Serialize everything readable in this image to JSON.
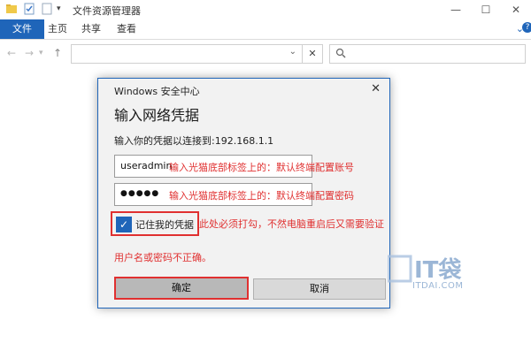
{
  "window": {
    "title": "文件资源管理器",
    "controls": [
      "minimize-icon",
      "maximize-icon",
      "close-icon"
    ]
  },
  "ribbon": {
    "tabs": [
      "文件",
      "主页",
      "共享",
      "查看"
    ],
    "help_glyph": "?"
  },
  "address_bar": {
    "value": "",
    "search_placeholder": ""
  },
  "dialog": {
    "title": "Windows 安全中心",
    "heading": "输入网络凭据",
    "subtitle": "输入你的凭据以连接到:192.168.1.1",
    "username_value": "useradmin",
    "username_note": "输入光猫底部标签上的：默认终端配置账号",
    "password_mask": "●●●●●",
    "password_note": "输入光猫底部标签上的：默认终端配置密码",
    "remember_label": "记住我的凭据",
    "remember_checked": true,
    "remember_note": "此处必须打勾，不然电脑重启后又需要验证",
    "error_message": "用户名或密码不正确。",
    "ok_label": "确定",
    "cancel_label": "取消"
  },
  "watermark": {
    "brand": "IT袋",
    "site": "ITDAI.COM"
  },
  "colors": {
    "accent": "#1f65b9",
    "annotation_red": "#e03030"
  }
}
